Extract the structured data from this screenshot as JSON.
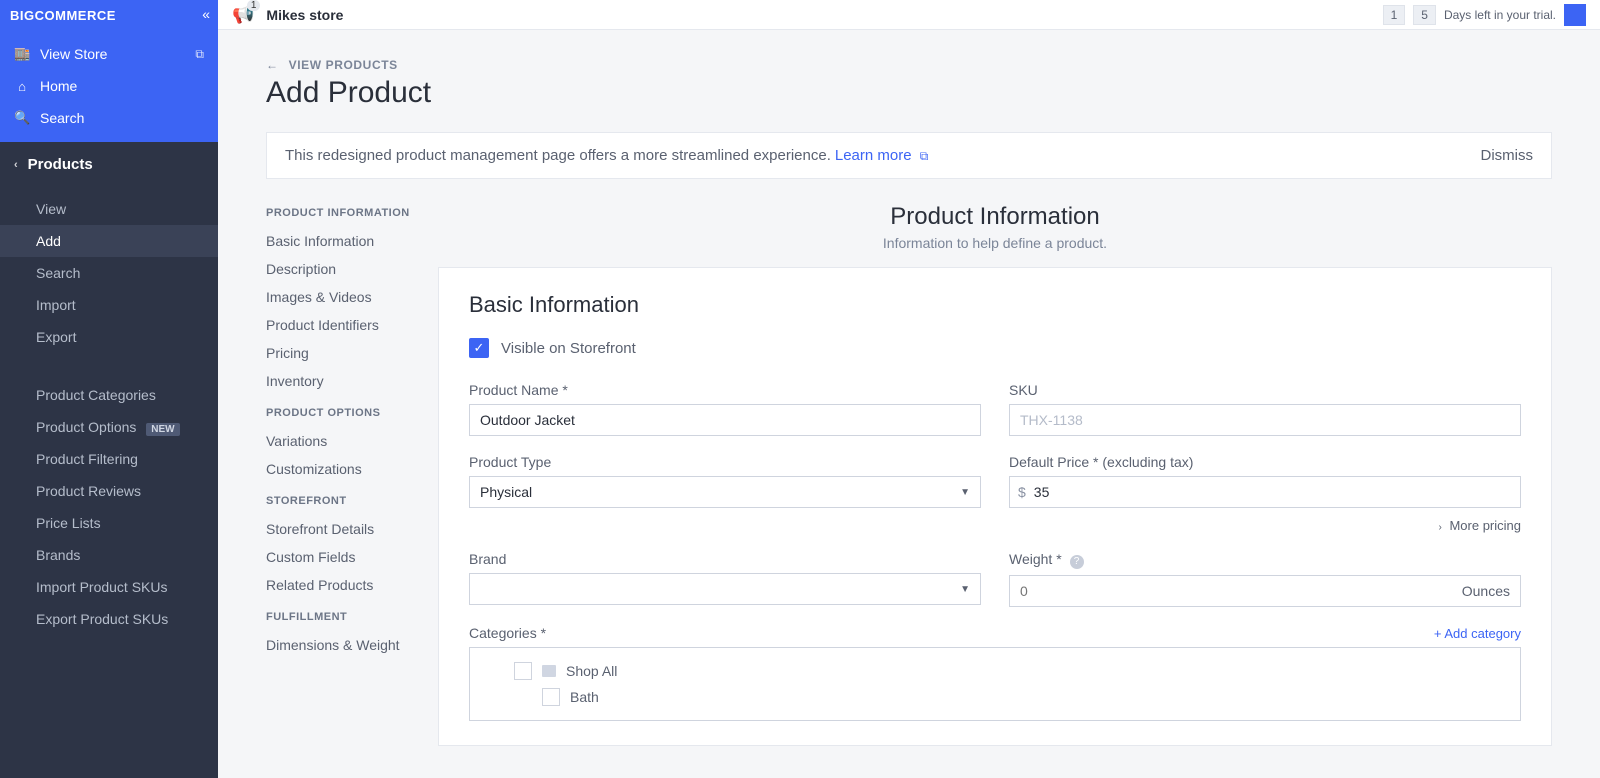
{
  "brand": "BIGCOMMERCE",
  "topbar": {
    "store_name": "Mikes store",
    "bell_count": "1",
    "trial_days": [
      "1",
      "5"
    ],
    "trial_text": "Days left in your trial."
  },
  "sidebar": {
    "view_store": "View Store",
    "home": "Home",
    "search": "Search",
    "current_section": "Products",
    "subitems": {
      "view": "View",
      "add": "Add",
      "search": "Search",
      "import": "Import",
      "export": "Export"
    },
    "groups": {
      "categories": "Product Categories",
      "options": "Product Options",
      "options_badge": "NEW",
      "filtering": "Product Filtering",
      "reviews": "Product Reviews",
      "pricelists": "Price Lists",
      "brands": "Brands",
      "import_skus": "Import Product SKUs",
      "export_skus": "Export Product SKUs"
    }
  },
  "page": {
    "back": "VIEW PRODUCTS",
    "title": "Add Product",
    "notice_text": "This redesigned product management page offers a more streamlined experience.",
    "notice_link": "Learn more",
    "notice_dismiss": "Dismiss"
  },
  "quicknav": {
    "h1": "PRODUCT INFORMATION",
    "basic": "Basic Information",
    "description": "Description",
    "images": "Images & Videos",
    "identifiers": "Product Identifiers",
    "pricing": "Pricing",
    "inventory": "Inventory",
    "h2": "PRODUCT OPTIONS",
    "variations": "Variations",
    "customizations": "Customizations",
    "h3": "STOREFRONT",
    "sf_details": "Storefront Details",
    "custom_fields": "Custom Fields",
    "related": "Related Products",
    "h4": "FULFILLMENT",
    "dims": "Dimensions & Weight"
  },
  "section": {
    "title": "Product Information",
    "subtitle": "Information to help define a product."
  },
  "form": {
    "card_title": "Basic Information",
    "visible_label": "Visible on Storefront",
    "name_label": "Product Name *",
    "name_value": "Outdoor Jacket",
    "sku_label": "SKU",
    "sku_placeholder": "THX-1138",
    "type_label": "Product Type",
    "type_value": "Physical",
    "price_label": "Default Price * (excluding tax)",
    "price_currency": "$",
    "price_value": "35",
    "more_pricing": "More pricing",
    "brand_label": "Brand",
    "brand_value": "",
    "weight_label": "Weight *",
    "weight_placeholder": "0",
    "weight_unit": "Ounces",
    "categories_label": "Categories *",
    "add_category": "Add category",
    "cat_shop_all": "Shop All",
    "cat_bath": "Bath"
  }
}
